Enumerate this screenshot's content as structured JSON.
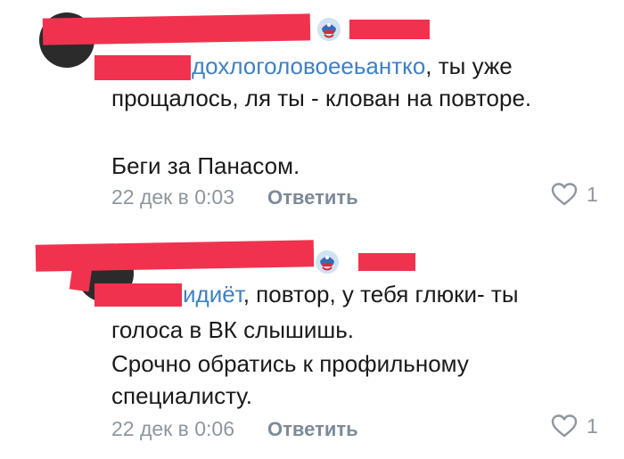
{
  "comments": [
    {
      "mention": "дохлоголовоееьантко",
      "text_after_mention": ", ты уже",
      "lines": [
        "прощалось, ля ты - клован на повторе.",
        "",
        "Беги за Панасом."
      ],
      "date": "22 дек в 0:03",
      "reply_label": "Ответить",
      "likes": "1"
    },
    {
      "mention": "идиёт",
      "text_after_mention": ", повтор, у тебя глюки- ты",
      "lines": [
        "голоса в ВК слышишь.",
        "Срочно обратись к профильному",
        "специалисту."
      ],
      "date": "22 дек в 0:06",
      "reply_label": "Ответить",
      "likes": "1"
    }
  ],
  "colors": {
    "redaction": "#f0324e",
    "mention": "#3f80c4",
    "meta": "#8f969d"
  },
  "icons": [
    "captain-america-badge-icon",
    "heart-outline-icon"
  ]
}
